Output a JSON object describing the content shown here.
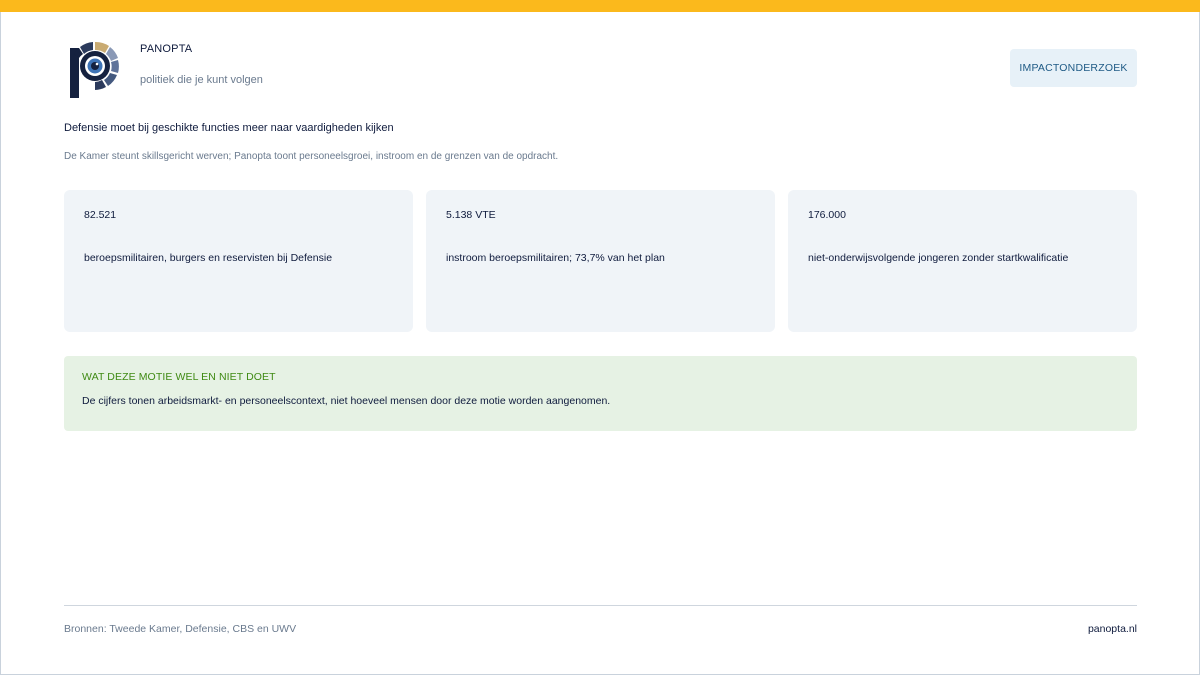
{
  "brand": {
    "name": "PANOPTA",
    "tagline": "politiek die je kunt volgen"
  },
  "header": {
    "cta_label": "IMPACTONDERZOEK"
  },
  "main": {
    "headline": "Defensie moet bij geschikte functies meer naar vaardigheden kijken",
    "subline": "De Kamer steunt skillsgericht werven; Panopta toont personeelsgroei, instroom en de grenzen van de opdracht.",
    "stats": [
      {
        "value": "82.521",
        "description": "beroepsmilitairen, burgers en reservisten bij Defensie"
      },
      {
        "value": "5.138 VTE",
        "description": "instroom beroepsmilitairen; 73,7% van het plan"
      },
      {
        "value": "176.000",
        "description": "niet-onderwijsvolgende jongeren zonder startkwalificatie"
      }
    ],
    "note": {
      "title": "WAT DEZE MOTIE WEL EN NIET DOET",
      "text": "De cijfers tonen arbeidsmarkt- en personeelscontext, niet hoeveel mensen door deze motie worden aangenomen."
    }
  },
  "footer": {
    "sources": "Bronnen: Tweede Kamer, Defensie, CBS en UWV",
    "site": "panopta.nl"
  },
  "colors": {
    "accent": "#fbb91c",
    "navy": "#0f1b3d",
    "note_green": "#3f8a13",
    "note_bg": "#e6f2e4",
    "card_bg": "#f0f4f8"
  }
}
